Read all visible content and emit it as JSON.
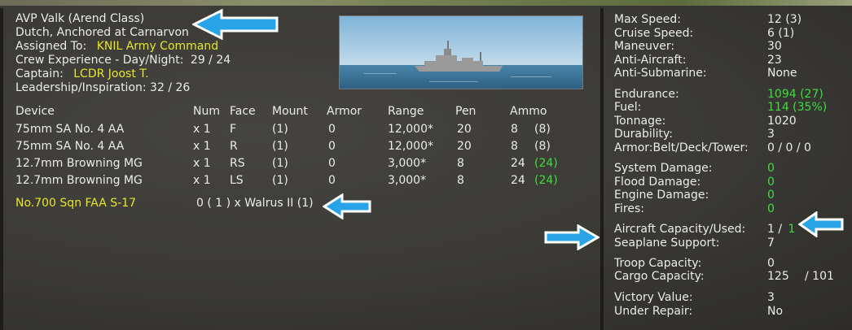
{
  "ship": {
    "name": "AVP Valk (Arend Class)",
    "status": "Dutch, Anchored at Carnarvon",
    "assigned_label": "Assigned To:",
    "assigned_value": "KNIL Army Command",
    "crew_label": "Crew Experience - Day/Night:",
    "crew_value": "29 / 24",
    "captain_label": "Captain:",
    "captain_value": "LCDR Joost T.",
    "leadership": "Leadership/Inspiration: 32 / 26"
  },
  "devices": {
    "headers": [
      "Device",
      "Num",
      "Face",
      "Mount",
      "Armor",
      "Range",
      "Pen",
      "Ammo"
    ],
    "rows": [
      {
        "device": "75mm SA No. 4 AA",
        "num": "x 1",
        "face": "F",
        "mount": "(1)",
        "armor": "0",
        "range": "12,000*",
        "pen": "20",
        "ammo": "8",
        "ammo_max": "(8)",
        "ammo_color": "white"
      },
      {
        "device": "75mm SA No. 4 AA",
        "num": "x 1",
        "face": "R",
        "mount": "(1)",
        "armor": "0",
        "range": "12,000*",
        "pen": "20",
        "ammo": "8",
        "ammo_max": "(8)",
        "ammo_color": "white"
      },
      {
        "device": "12.7mm Browning MG",
        "num": "x 1",
        "face": "RS",
        "mount": "(1)",
        "armor": "0",
        "range": "3,000*",
        "pen": "8",
        "ammo": "24",
        "ammo_max": "(24)",
        "ammo_color": "green"
      },
      {
        "device": "12.7mm Browning MG",
        "num": "x 1",
        "face": "LS",
        "mount": "(1)",
        "armor": "0",
        "range": "3,000*",
        "pen": "8",
        "ammo": "24",
        "ammo_max": "(24)",
        "ammo_color": "green"
      }
    ]
  },
  "aircraft": {
    "unit": "No.700 Sqn FAA S-17",
    "detail": "0 ( 1 ) x Walrus II (1)"
  },
  "stats": {
    "max_speed_label": "Max Speed:",
    "max_speed_value": "12 (3)",
    "cruise_speed_label": "Cruise Speed:",
    "cruise_speed_value": "6 (1)",
    "maneuver_label": "Maneuver:",
    "maneuver_value": "30",
    "aa_label": "Anti-Aircraft:",
    "aa_value": "23",
    "asw_label": "Anti-Submarine:",
    "asw_value": "None",
    "endurance_label": "Endurance:",
    "endurance_value": "1094 (27)",
    "fuel_label": "Fuel:",
    "fuel_value": "114 (35%)",
    "tonnage_label": "Tonnage:",
    "tonnage_value": "1020",
    "durability_label": "Durability:",
    "durability_value": "3",
    "armor_label": "Armor:Belt/Deck/Tower:",
    "armor_value": "0 / 0 / 0",
    "sys_dmg_label": "System Damage:",
    "sys_dmg_value": "0",
    "flood_dmg_label": "Flood Damage:",
    "flood_dmg_value": "0",
    "engine_dmg_label": "Engine Damage:",
    "engine_dmg_value": "0",
    "fires_label": "Fires:",
    "fires_value": "0",
    "aircraft_cap_label": "Aircraft Capacity/Used:",
    "aircraft_cap_value": "1 /",
    "aircraft_used_value": "1",
    "seaplane_label": "Seaplane Support:",
    "seaplane_value": "7",
    "troop_label": "Troop Capacity:",
    "troop_value": "0",
    "cargo_label": "Cargo Capacity:",
    "cargo_value": "125",
    "cargo_value2": "/ 101",
    "victory_label": "Victory Value:",
    "victory_value": "3",
    "repair_label": "Under Repair:",
    "repair_value": "No"
  },
  "colors": {
    "highlight_yellow": "#e6e62a",
    "highlight_green": "#3edc3e",
    "annotation_arrow": "#29a3e8"
  },
  "icons": {
    "annotation": "arrow-icon",
    "ship_image": "ship-photo"
  }
}
